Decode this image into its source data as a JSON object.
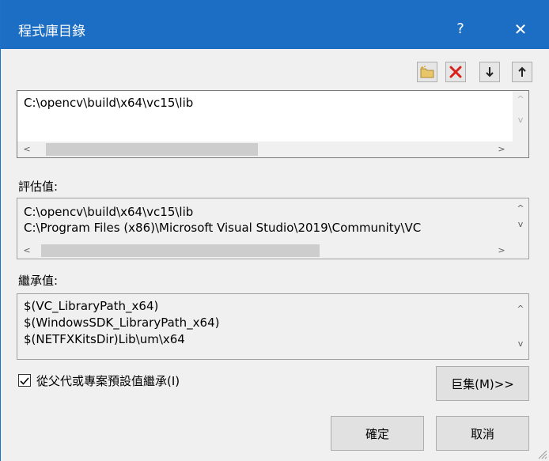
{
  "window": {
    "title": "程式庫目錄",
    "help_glyph": "?",
    "close_glyph": "✕"
  },
  "toolbar": {
    "new_icon": "new-folder-icon",
    "delete_icon": "delete-icon",
    "down_icon": "arrow-down-icon",
    "up_icon": "arrow-up-icon"
  },
  "path_list": {
    "items": [
      "C:\\opencv\\build\\x64\\vc15\\lib"
    ]
  },
  "evaluated": {
    "label": "評估值:",
    "lines": [
      "C:\\opencv\\build\\x64\\vc15\\lib",
      "C:\\Program Files (x86)\\Microsoft Visual Studio\\2019\\Community\\VC"
    ]
  },
  "inherited": {
    "label": "繼承值:",
    "lines": [
      "$(VC_LibraryPath_x64)",
      "$(WindowsSDK_LibraryPath_x64)",
      "$(NETFXKitsDir)Lib\\um\\x64"
    ]
  },
  "inherit_checkbox": {
    "label": "從父代或專案預設值繼承(I)",
    "checked": true
  },
  "buttons": {
    "macros": "巨集(M)>>",
    "ok": "確定",
    "cancel": "取消"
  },
  "scroll_glyphs": {
    "up": "^",
    "down": "v",
    "left": "<",
    "right": ">"
  }
}
